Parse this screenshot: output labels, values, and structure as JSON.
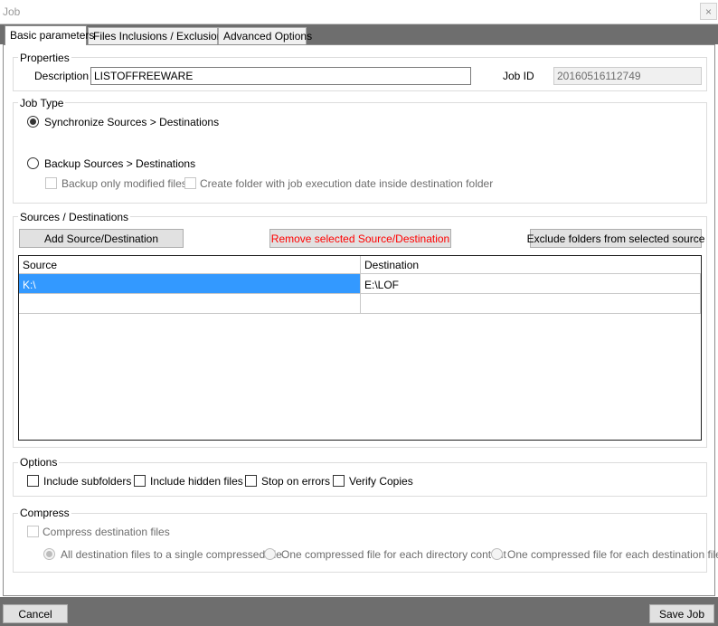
{
  "window": {
    "title": "Job",
    "close_glyph": "×"
  },
  "tabs": [
    {
      "label": "Basic parameters",
      "active": true
    },
    {
      "label": "Files Inclusions / Exclusions",
      "active": false
    },
    {
      "label": "Advanced Options",
      "active": false
    }
  ],
  "properties": {
    "legend": "Properties",
    "description_label": "Description",
    "description_value": "LISTOFFREEWARE",
    "jobid_label": "Job ID",
    "jobid_value": "20160516112749"
  },
  "job_type": {
    "legend": "Job Type",
    "sync_label": "Synchronize Sources > Destinations",
    "sync_checked": true,
    "backup_label": "Backup Sources > Destinations",
    "backup_checked": false,
    "backup_modified_label": "Backup only modified files",
    "create_folder_label": "Create folder with job execution date inside destination folder"
  },
  "sources": {
    "legend": "Sources / Destinations",
    "add_label": "Add Source/Destination",
    "remove_label": "Remove selected Source/Destination",
    "exclude_label": "Exclude folders from selected source",
    "columns": [
      "Source",
      "Destination"
    ],
    "rows": [
      {
        "source": "K:\\",
        "destination": "E:\\LOF"
      },
      {
        "source": "",
        "destination": ""
      }
    ]
  },
  "options": {
    "legend": "Options",
    "include_subfolders": "Include subfolders",
    "include_hidden": "Include hidden files",
    "stop_on_errors": "Stop on errors",
    "verify_copies": "Verify Copies"
  },
  "compress": {
    "legend": "Compress",
    "compress_label": "Compress destination files",
    "mode_single": "All destination files to a single compressed file",
    "mode_per_dir": "One compressed file for each directory content",
    "mode_per_file": "One compressed file for each destination file"
  },
  "footer": {
    "cancel_label": "Cancel",
    "save_label": "Save Job"
  },
  "colors": {
    "selection": "#3399ff",
    "remove_text": "#ff0000",
    "chrome": "#6e6e6e"
  }
}
